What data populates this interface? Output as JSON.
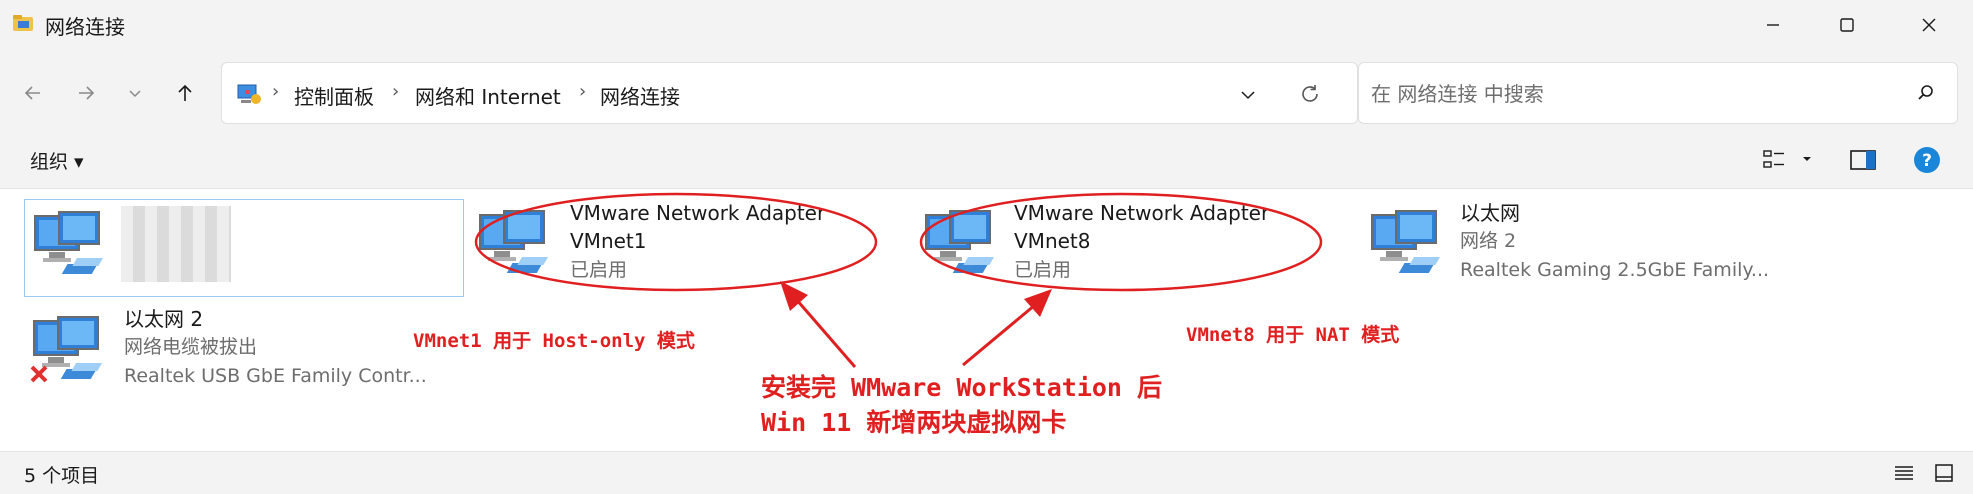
{
  "window": {
    "title": "网络连接"
  },
  "address": {
    "crumbs": [
      "控制面板",
      "网络和 Internet",
      "网络连接"
    ]
  },
  "search": {
    "placeholder": "在 网络连接 中搜索"
  },
  "toolbar": {
    "organize_label": "组织 ▾"
  },
  "items": [
    {
      "name_line1": "",
      "name_line2": "",
      "status": "",
      "blurred": true
    },
    {
      "name_line1": "VMware Network Adapter",
      "name_line2": "VMnet1",
      "status": "已启用"
    },
    {
      "name_line1": "VMware Network Adapter",
      "name_line2": "VMnet8",
      "status": "已启用"
    },
    {
      "name_line1": "以太网",
      "status": "网络 2",
      "device": "Realtek Gaming 2.5GbE Family..."
    },
    {
      "name_line1": "以太网 2",
      "status": "网络电缆被拔出",
      "device": "Realtek USB GbE Family Contr..."
    }
  ],
  "status": {
    "count": "5 个项目"
  },
  "annotations": {
    "vmnet1_note": "VMnet1 用于 Host-only 模式",
    "vmnet8_note": "VMnet8 用于 NAT 模式",
    "main_line1": "安装完 WMware WorkStation 后",
    "main_line2": "Win 11 新增两块虚拟网卡"
  },
  "colors": {
    "annotation": "#e02020",
    "accent": "#0067c0"
  }
}
